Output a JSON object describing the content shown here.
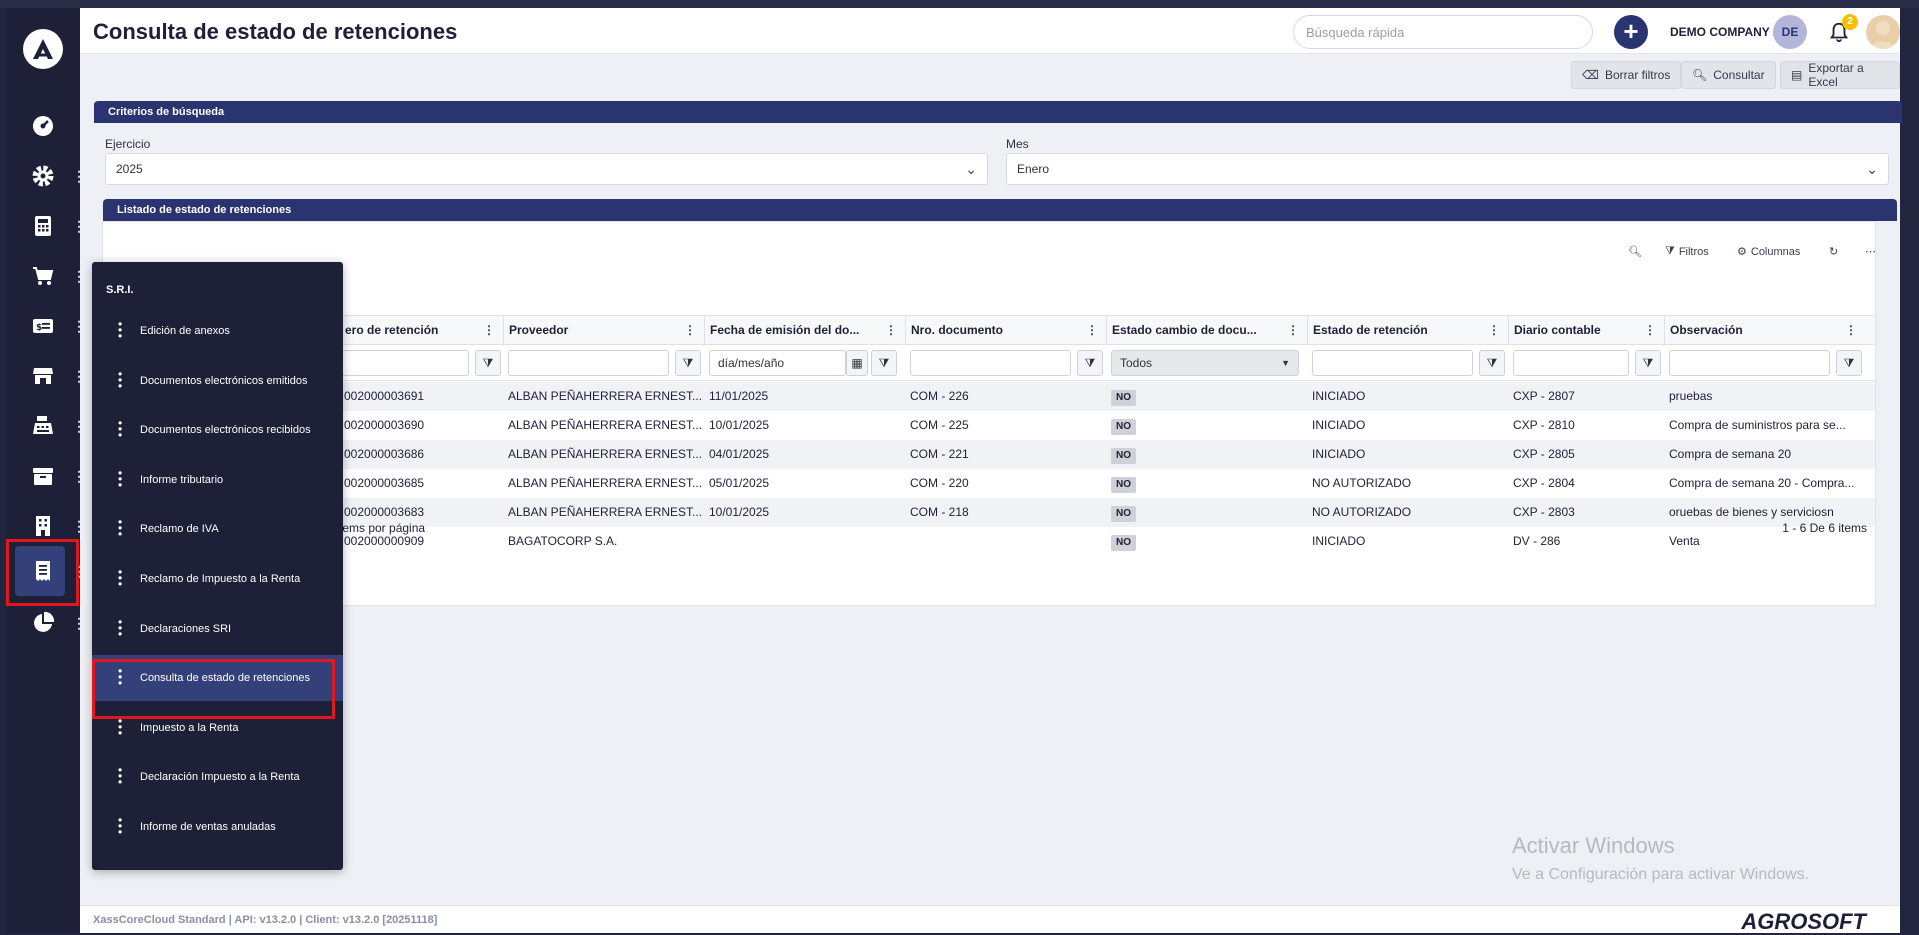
{
  "header": {
    "title": "Consulta de estado de retenciones",
    "search_placeholder": "Búsqueda rápida",
    "company": "DEMO COMPANY 2",
    "avatar_initials": "DE",
    "notification_count": "2"
  },
  "toolbar": {
    "clear_filters": "Borrar filtros",
    "query": "Consultar",
    "export": "Exportar a Excel"
  },
  "criteria": {
    "title": "Criterios de búsqueda",
    "year_label": "Ejercicio",
    "year_value": "2025",
    "month_label": "Mes",
    "month_value": "Enero"
  },
  "list": {
    "title": "Listado de estado de retenciones",
    "tools": {
      "filters": "Filtros",
      "columns": "Columnas"
    },
    "columns": [
      "ero de retención",
      "Proveedor",
      "Fecha de emisión del do...",
      "Nro. documento",
      "Estado cambio de docu...",
      "Estado de retención",
      "Diario contable",
      "Observación"
    ],
    "date_placeholder": "día/mes/año",
    "state_filter": "Todos",
    "rows": [
      {
        "num": "002000003691",
        "prov": "ALBAN PEÑAHERRERA ERNEST...",
        "fecha": "11/01/2025",
        "doc": "COM - 226",
        "cambio": "NO",
        "estado": "INICIADO",
        "diario": "CXP - 2807",
        "obs": "pruebas"
      },
      {
        "num": "002000003690",
        "prov": "ALBAN PEÑAHERRERA ERNEST...",
        "fecha": "10/01/2025",
        "doc": "COM - 225",
        "cambio": "NO",
        "estado": "INICIADO",
        "diario": "CXP - 2810",
        "obs": "Compra de suministros para se..."
      },
      {
        "num": "002000003686",
        "prov": "ALBAN PEÑAHERRERA ERNEST...",
        "fecha": "04/01/2025",
        "doc": "COM - 221",
        "cambio": "NO",
        "estado": "INICIADO",
        "diario": "CXP - 2805",
        "obs": "Compra de semana 20"
      },
      {
        "num": "002000003685",
        "prov": "ALBAN PEÑAHERRERA ERNEST...",
        "fecha": "05/01/2025",
        "doc": "COM - 220",
        "cambio": "NO",
        "estado": "NO AUTORIZADO",
        "diario": "CXP - 2804",
        "obs": "Compra de semana 20 - Compra..."
      },
      {
        "num": "002000003683",
        "prov": "ALBAN PEÑAHERRERA ERNEST...",
        "fecha": "10/01/2025",
        "doc": "COM - 218",
        "cambio": "NO",
        "estado": "NO AUTORIZADO",
        "diario": "CXP - 2803",
        "obs": "oruebas de bienes y serviciosn"
      },
      {
        "num": "002000000909",
        "prov": "BAGATOCORP S.A.",
        "fecha": "",
        "doc": "",
        "cambio": "NO",
        "estado": "INICIADO",
        "diario": "DV - 286",
        "obs": "Venta"
      }
    ],
    "items_per_page": "tems por página",
    "range": "1 - 6 De 6 items"
  },
  "sri_menu": {
    "title": "S.R.I.",
    "items": [
      "Edición de anexos",
      "Documentos electrónicos emitidos",
      "Documentos electrónicos recibidos",
      "Informe tributario",
      "Reclamo de IVA",
      "Reclamo de Impuesto a la Renta",
      "Declaraciones SRI",
      "Consulta de estado de retenciones",
      "Impuesto a la Renta",
      "Declaración Impuesto a la Renta",
      "Informe de ventas anuladas"
    ]
  },
  "footer": {
    "version": "XassCoreCloud Standard | API: v13.2.0 | Client: v13.2.0 [20251118]",
    "brand": "AGROSOFT"
  },
  "watermark": {
    "line1": "Activar Windows",
    "line2": "Ve a Configuración para activar Windows."
  },
  "colors": {
    "accent": "#2a3470",
    "sidebar": "#1d2036",
    "highlight": "#e0171e"
  }
}
